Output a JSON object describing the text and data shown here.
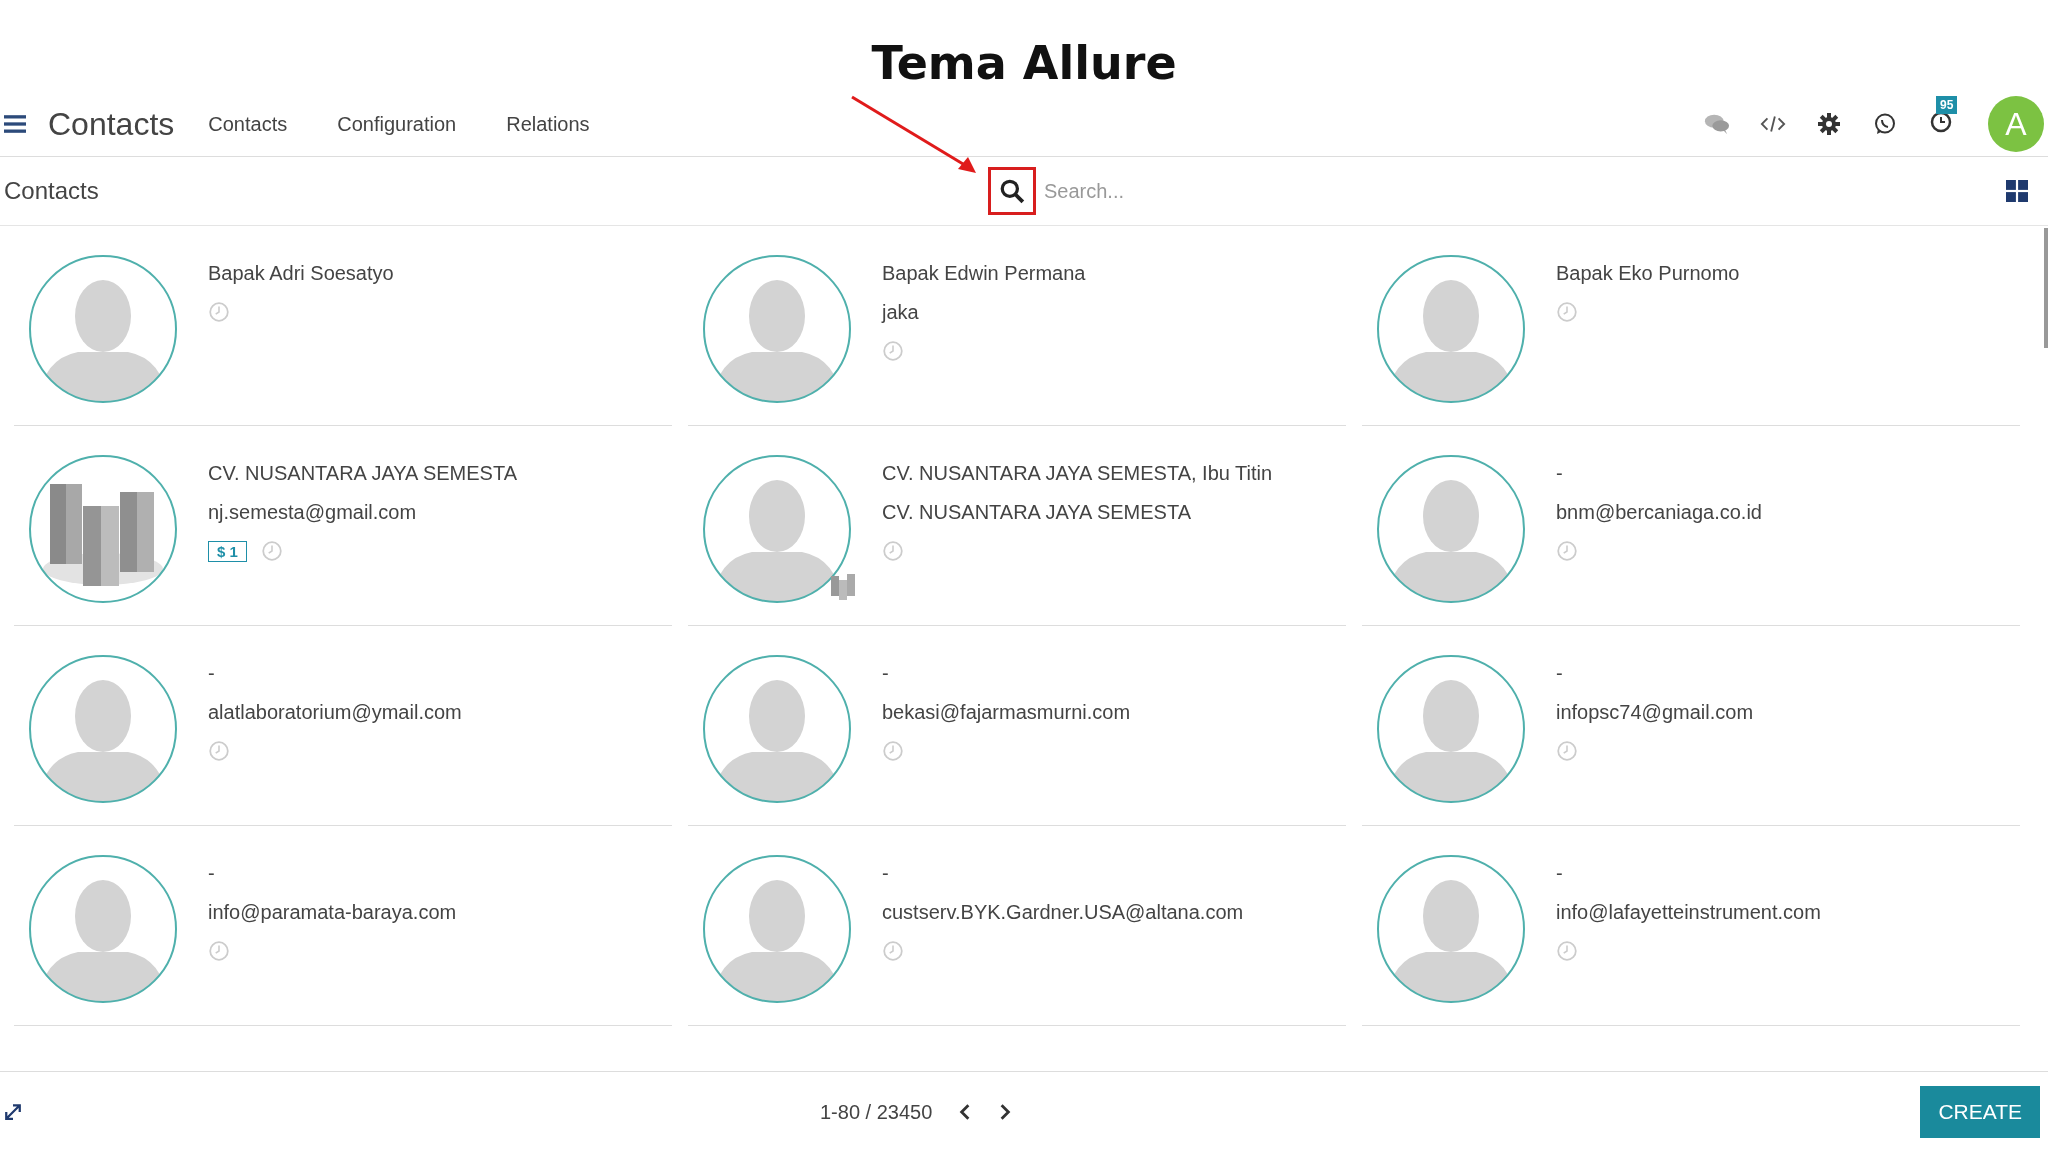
{
  "page_title": "Tema Allure",
  "navbar": {
    "app_name": "Contacts",
    "menu": [
      "Contacts",
      "Configuration",
      "Relations"
    ],
    "activity_count": "95",
    "avatar_letter": "A"
  },
  "control_panel": {
    "breadcrumb": "Contacts",
    "search": {
      "placeholder": "Search..."
    }
  },
  "cards": [
    {
      "kind": "person",
      "company_badge": false,
      "lines": [
        "Bapak Adri Soesatyo"
      ]
    },
    {
      "kind": "person",
      "company_badge": false,
      "lines": [
        "Bapak Edwin Permana",
        "jaka"
      ]
    },
    {
      "kind": "person",
      "company_badge": false,
      "lines": [
        "Bapak Eko Purnomo"
      ]
    },
    {
      "kind": "company",
      "company_badge": false,
      "lines": [
        "CV. NUSANTARA JAYA SEMESTA",
        "nj.semesta@gmail.com"
      ],
      "tag": "$ 1"
    },
    {
      "kind": "person",
      "company_badge": true,
      "lines": [
        "CV. NUSANTARA JAYA SEMESTA, Ibu Titin",
        "CV. NUSANTARA JAYA SEMESTA"
      ]
    },
    {
      "kind": "person",
      "company_badge": false,
      "lines": [
        "-",
        "bnm@bercaniaga.co.id"
      ]
    },
    {
      "kind": "person",
      "company_badge": false,
      "lines": [
        "-",
        "alatlaboratorium@ymail.com"
      ]
    },
    {
      "kind": "person",
      "company_badge": false,
      "lines": [
        "-",
        "bekasi@fajarmasmurni.com"
      ]
    },
    {
      "kind": "person",
      "company_badge": false,
      "lines": [
        "-",
        "infopsc74@gmail.com"
      ]
    },
    {
      "kind": "person",
      "company_badge": false,
      "lines": [
        "-",
        "info@paramata-baraya.com"
      ]
    },
    {
      "kind": "person",
      "company_badge": false,
      "lines": [
        "-",
        "custserv.BYK.Gardner.USA@altana.com"
      ]
    },
    {
      "kind": "person",
      "company_badge": false,
      "lines": [
        "-",
        "info@lafayetteinstrument.com"
      ]
    }
  ],
  "pager": {
    "range": "1-80 / 23450"
  },
  "create_button": "CREATE"
}
